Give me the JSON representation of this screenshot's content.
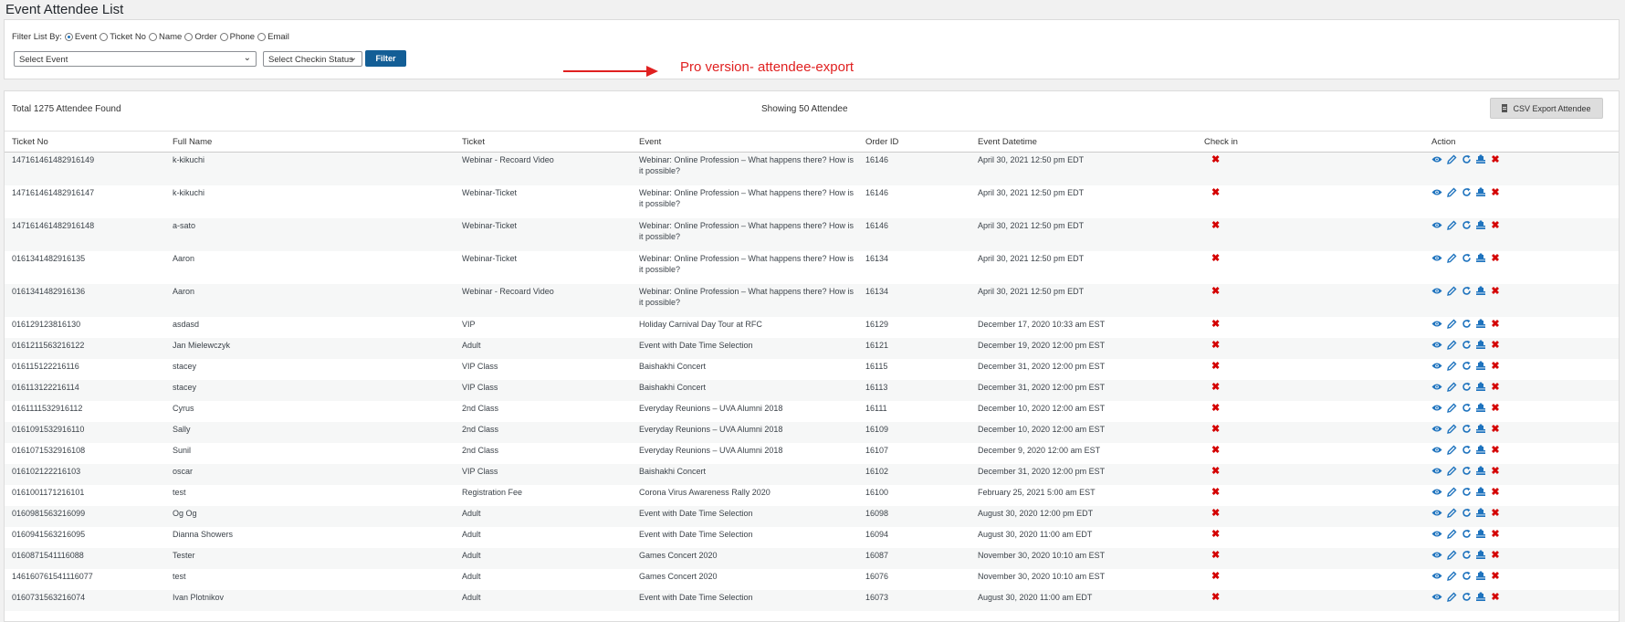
{
  "page_title": "Event Attendee List",
  "filter": {
    "label": "Filter List By:",
    "options": [
      {
        "label": "Event",
        "checked": true
      },
      {
        "label": "Ticket No",
        "checked": false
      },
      {
        "label": "Name",
        "checked": false
      },
      {
        "label": "Order",
        "checked": false
      },
      {
        "label": "Phone",
        "checked": false
      },
      {
        "label": "Email",
        "checked": false
      }
    ],
    "select_event": "Select Event",
    "select_checkin": "Select Checkin Status",
    "button": "Filter"
  },
  "annotation": {
    "text": "Pro version- attendee-export",
    "color": "#e02020"
  },
  "summary": {
    "total": "Total 1275 Attendee Found",
    "showing": "Showing 50 Attendee",
    "csv_button": "CSV Export Attendee"
  },
  "table": {
    "columns": [
      "Ticket No",
      "Full Name",
      "Ticket",
      "Event",
      "Order ID",
      "Event Datetime",
      "Check in",
      "Action"
    ],
    "rows": [
      {
        "ticket_no": "147161461482916149",
        "name": "k-kikuchi",
        "ticket": "Webinar - Recoard Video",
        "event": "Webinar: Online Profession – What happens there? How is it possible?",
        "order": "16146",
        "datetime": "April 30, 2021 12:50 pm EDT"
      },
      {
        "ticket_no": "147161461482916147",
        "name": "k-kikuchi",
        "ticket": "Webinar-Ticket",
        "event": "Webinar: Online Profession – What happens there? How is it possible?",
        "order": "16146",
        "datetime": "April 30, 2021 12:50 pm EDT"
      },
      {
        "ticket_no": "147161461482916148",
        "name": "a-sato",
        "ticket": "Webinar-Ticket",
        "event": "Webinar: Online Profession – What happens there? How is it possible?",
        "order": "16146",
        "datetime": "April 30, 2021 12:50 pm EDT"
      },
      {
        "ticket_no": "0161341482916135",
        "name": "Aaron",
        "ticket": "Webinar-Ticket",
        "event": "Webinar: Online Profession – What happens there? How is it possible?",
        "order": "16134",
        "datetime": "April 30, 2021 12:50 pm EDT"
      },
      {
        "ticket_no": "0161341482916136",
        "name": "Aaron",
        "ticket": "Webinar - Recoard Video",
        "event": "Webinar: Online Profession – What happens there? How is it possible?",
        "order": "16134",
        "datetime": "April 30, 2021 12:50 pm EDT"
      },
      {
        "ticket_no": "016129123816130",
        "name": "asdasd",
        "ticket": "VIP",
        "event": "Holiday Carnival Day Tour at RFC",
        "order": "16129",
        "datetime": "December 17, 2020 10:33 am EST"
      },
      {
        "ticket_no": "0161211563216122",
        "name": "Jan Mielewczyk",
        "ticket": "Adult",
        "event": "Event with Date Time Selection",
        "order": "16121",
        "datetime": "December 19, 2020 12:00 pm EST"
      },
      {
        "ticket_no": "016115122216116",
        "name": "stacey",
        "ticket": "VIP Class",
        "event": "Baishakhi Concert",
        "order": "16115",
        "datetime": "December 31, 2020 12:00 pm EST"
      },
      {
        "ticket_no": "016113122216114",
        "name": "stacey",
        "ticket": "VIP Class",
        "event": "Baishakhi Concert",
        "order": "16113",
        "datetime": "December 31, 2020 12:00 pm EST"
      },
      {
        "ticket_no": "0161111532916112",
        "name": "Cyrus",
        "ticket": "2nd Class",
        "event": "Everyday Reunions – UVA Alumni 2018",
        "order": "16111",
        "datetime": "December 10, 2020 12:00 am EST"
      },
      {
        "ticket_no": "0161091532916110",
        "name": "Sally",
        "ticket": "2nd Class",
        "event": "Everyday Reunions – UVA Alumni 2018",
        "order": "16109",
        "datetime": "December 10, 2020 12:00 am EST"
      },
      {
        "ticket_no": "0161071532916108",
        "name": "Sunil",
        "ticket": "2nd Class",
        "event": "Everyday Reunions – UVA Alumni 2018",
        "order": "16107",
        "datetime": "December 9, 2020 12:00 am EST"
      },
      {
        "ticket_no": "016102122216103",
        "name": "oscar",
        "ticket": "VIP Class",
        "event": "Baishakhi Concert",
        "order": "16102",
        "datetime": "December 31, 2020 12:00 pm EST"
      },
      {
        "ticket_no": "0161001171216101",
        "name": "test",
        "ticket": "Registration Fee",
        "event": "Corona Virus Awareness Rally 2020",
        "order": "16100",
        "datetime": "February 25, 2021 5:00 am EST"
      },
      {
        "ticket_no": "0160981563216099",
        "name": "Og Og",
        "ticket": "Adult",
        "event": "Event with Date Time Selection",
        "order": "16098",
        "datetime": "August 30, 2020 12:00 pm EDT"
      },
      {
        "ticket_no": "0160941563216095",
        "name": "Dianna Showers",
        "ticket": "Adult",
        "event": "Event with Date Time Selection",
        "order": "16094",
        "datetime": "August 30, 2020 11:00 am EDT"
      },
      {
        "ticket_no": "0160871541116088",
        "name": "Tester",
        "ticket": "Adult",
        "event": "Games Concert 2020",
        "order": "16087",
        "datetime": "November 30, 2020 10:10 am EST"
      },
      {
        "ticket_no": "146160761541116077",
        "name": "test",
        "ticket": "Adult",
        "event": "Games Concert 2020",
        "order": "16076",
        "datetime": "November 30, 2020 10:10 am EST"
      },
      {
        "ticket_no": "0160731563216074",
        "name": "Ivan Plotnikov",
        "ticket": "Adult",
        "event": "Event with Date Time Selection",
        "order": "16073",
        "datetime": "August 30, 2020 11:00 am EDT"
      }
    ],
    "checkin_mark": "✖",
    "action_icons": [
      "view-icon",
      "edit-icon",
      "resend-icon",
      "checkin-icon",
      "delete-icon"
    ]
  },
  "colors": {
    "primary_button": "#135e96",
    "checkin_no": "#d40000",
    "icon": "#1e73be"
  }
}
